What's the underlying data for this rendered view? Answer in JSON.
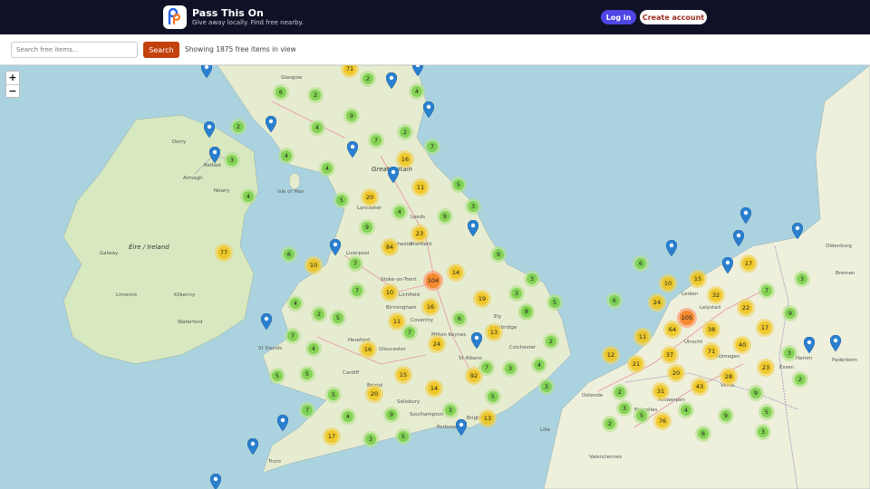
{
  "header": {
    "app_name": "Pass This On",
    "tagline": "Give away locally. Find free nearby.",
    "login_label": "Log in",
    "create_label": "Create account"
  },
  "search": {
    "placeholder": "Search free items...",
    "button_label": "Search",
    "status": "Showing 1875 free items in view"
  },
  "zoom": {
    "in": "+",
    "out": "−"
  },
  "colors": {
    "header_bg": "#0f1226",
    "login": "#4f46e5",
    "search_btn": "#c2410c",
    "sea": "#aad3df",
    "land": "#f2efe9"
  },
  "map_labels": [
    "Glasgow",
    "Great Britain",
    "Isle of Man",
    "Belfast",
    "Derry",
    "Armagh",
    "Newry",
    "Éire / Ireland",
    "Galway",
    "Limerick",
    "Kilkenny",
    "Waterford",
    "Liverpool",
    "Manchester",
    "Leeds",
    "Sheffield",
    "Lancaster",
    "Birmingham",
    "Coventry",
    "Lichfield",
    "Stoke-on-Trent",
    "Hereford",
    "Gloucester",
    "Cardiff",
    "St Davids",
    "Bristol",
    "Salisbury",
    "Southampton",
    "Portsmouth",
    "Brighton",
    "St Albans",
    "Milton Keynes",
    "Cambridge",
    "Ely",
    "Colchester",
    "Truro",
    "Leiden",
    "Utrecht",
    "Antwerpen",
    "Bruxelles",
    "Bremen",
    "Oldenburg",
    "Essen",
    "Hamm",
    "Paderborn",
    "Lelystad",
    "Venlo",
    "Nijmegen",
    "Ostende",
    "Valenciennes",
    "Lille"
  ],
  "clusters": [
    "71",
    "2",
    "4",
    "6",
    "2",
    "2",
    "4",
    "9",
    "2",
    "7",
    "4",
    "7",
    "3",
    "16",
    "4",
    "4",
    "5",
    "20",
    "11",
    "5",
    "4",
    "9",
    "3",
    "9",
    "23",
    "84",
    "77",
    "6",
    "10",
    "7",
    "9",
    "104",
    "14",
    "4",
    "3",
    "7",
    "10",
    "16",
    "19",
    "3",
    "5",
    "2",
    "5",
    "3",
    "11",
    "7",
    "6",
    "8",
    "13",
    "24",
    "2",
    "7",
    "4",
    "16",
    "92",
    "7",
    "3",
    "4",
    "5",
    "15",
    "14",
    "5",
    "5",
    "3",
    "20",
    "9",
    "3",
    "13",
    "7",
    "4",
    "5",
    "3",
    "5",
    "17",
    "6",
    "6",
    "10",
    "24",
    "15",
    "32",
    "17",
    "22",
    "7",
    "3",
    "105",
    "11",
    "38",
    "64",
    "40",
    "37",
    "71",
    "12",
    "21",
    "20",
    "28",
    "23",
    "2",
    "3",
    "31",
    "43",
    "9",
    "5",
    "76",
    "4",
    "9",
    "8",
    "2",
    "5",
    "3",
    "3",
    "2",
    "9",
    "17"
  ]
}
